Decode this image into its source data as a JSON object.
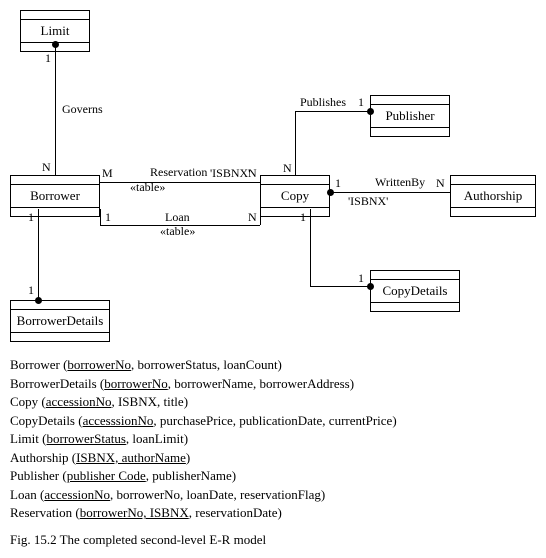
{
  "entities": {
    "limit": "Limit",
    "borrower": "Borrower",
    "borrowerDetails": "BorrowerDetails",
    "copy": "Copy",
    "copyDetails": "CopyDetails",
    "publisher": "Publisher",
    "authorship": "Authorship"
  },
  "rel": {
    "governs": "Governs",
    "reservation": "Reservation",
    "reservation_stereo": "«table»",
    "reservation_key": "'ISBNX'",
    "loan": "Loan",
    "loan_stereo": "«table»",
    "publishes": "Publishes",
    "writtenby": "WrittenBy",
    "writtenby_key": "'ISBNX'"
  },
  "card": {
    "c1": "1",
    "cN": "N",
    "cM": "M"
  },
  "schema": {
    "borrower": {
      "name": "Borrower",
      "pk": "borrowerNo",
      "rest": ", borrowerStatus, loanCount)"
    },
    "borrowerDetails": {
      "name": "BorrowerDetails",
      "pk": "borrowerNo",
      "rest": ", borrowerName, borrowerAddress)"
    },
    "copy": {
      "name": "Copy",
      "pk": "accessionNo",
      "rest": ", ISBNX, title)"
    },
    "copyDetails": {
      "name": "CopyDetails",
      "pk": "accesssionNo",
      "rest": ", purchasePrice, publicationDate, currentPrice)"
    },
    "limit": {
      "name": "Limit",
      "pk": "borrowerStatus",
      "rest": ", loanLimit)"
    },
    "authorship": {
      "name": "Authorship",
      "pk": "ISBNX, authorName",
      "rest": ")"
    },
    "publisher": {
      "name": "Publisher",
      "pk": "publisher Code",
      "rest": ", publisherName)"
    },
    "loan": {
      "name": "Loan",
      "pk": "accessionNo",
      "rest": ", borrowerNo, loanDate, reservationFlag)"
    },
    "reservation": {
      "name": "Reservation",
      "pk": "borrowerNo, ISBNX",
      "rest": ", reservationDate)"
    }
  },
  "caption": "Fig. 15.2    The completed second-level E-R model"
}
